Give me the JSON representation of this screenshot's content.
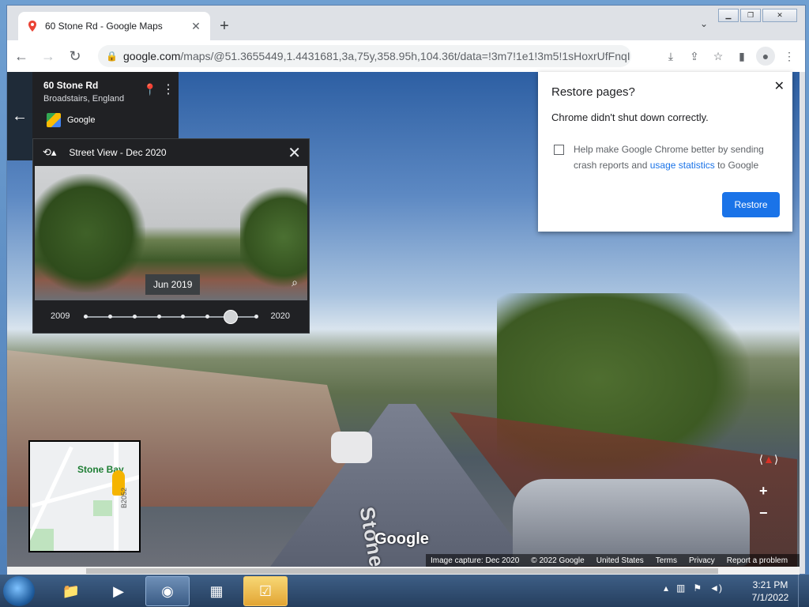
{
  "browser": {
    "tab_title": "60 Stone Rd - Google Maps",
    "new_tab": "+",
    "url_host": "google.com",
    "url_rest": "/maps/@51.3655449,1.4431681,3a,75y,358.95h,104.36t/data=!3m7!1e1!3m5!1sHoxrUfFnqI...",
    "icons": {
      "back": "←",
      "forward": "→",
      "reload": "↻",
      "lock": "🔒",
      "download": "⤓",
      "share": "⇪",
      "bookmark": "☆",
      "sidebar": "▮",
      "profile": "●",
      "menu": "⋮",
      "tab_close": "✕",
      "tab_search": "⌄"
    }
  },
  "place_card": {
    "title": "60 Stone Rd",
    "subtitle": "Broadstairs, England",
    "source": "Google"
  },
  "time_travel": {
    "header": "Street View - Dec 2020",
    "tooltip_date": "Jun 2019",
    "year_start": "2009",
    "year_end": "2020",
    "selected_index": 6,
    "stop_count": 8
  },
  "restore_dialog": {
    "title": "Restore pages?",
    "message": "Chrome didn't shut down correctly.",
    "help_text_prefix": "Help make Google Chrome better by sending crash reports and ",
    "help_link": "usage statistics",
    "help_text_suffix": " to Google",
    "restore_button": "Restore"
  },
  "minimap": {
    "place_label": "Stone Bay",
    "road_label": "B2052"
  },
  "street_view": {
    "road_label": "Stone Rd",
    "logo": "Google"
  },
  "footer": {
    "image_capture": "Image capture: Dec 2020",
    "copyright": "© 2022 Google",
    "country": "United States",
    "terms": "Terms",
    "privacy": "Privacy",
    "report": "Report a problem"
  },
  "taskbar": {
    "time": "3:21 PM",
    "date": "7/1/2022"
  },
  "colors": {
    "accent": "#1a73e8",
    "panel_dark": "#202124"
  }
}
